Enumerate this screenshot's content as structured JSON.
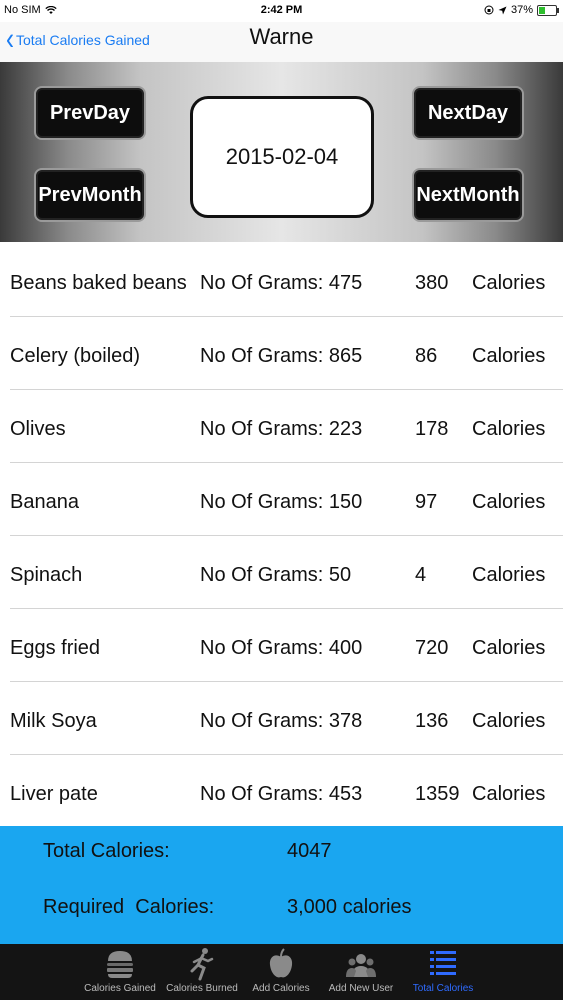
{
  "status": {
    "carrier": "No SIM",
    "time": "2:42 PM",
    "battery": "37%",
    "battery_level": 0.37
  },
  "nav": {
    "back_label": "Total Calories Gained",
    "title": "Warne"
  },
  "date_nav": {
    "prev_day": "PrevDay",
    "next_day": "NextDay",
    "prev_month": "PrevMonth",
    "next_month": "NextMonth",
    "date": "2015-02-04"
  },
  "foods": [
    {
      "name": "Beans baked beans",
      "grams": "No Of Grams: 475",
      "calories": "380",
      "unit": "Calories"
    },
    {
      "name": "Celery (boiled)",
      "grams": "No Of Grams: 865",
      "calories": "86",
      "unit": "Calories"
    },
    {
      "name": "Olives",
      "grams": "No Of Grams: 223",
      "calories": "178",
      "unit": "Calories"
    },
    {
      "name": "Banana",
      "grams": "No Of Grams: 150",
      "calories": "97",
      "unit": "Calories"
    },
    {
      "name": "Spinach",
      "grams": "No Of Grams: 50",
      "calories": "4",
      "unit": "Calories"
    },
    {
      "name": "Eggs fried",
      "grams": "No Of Grams: 400",
      "calories": "720",
      "unit": "Calories"
    },
    {
      "name": "Milk Soya",
      "grams": "No Of Grams: 378",
      "calories": "136",
      "unit": "Calories"
    },
    {
      "name": "Liver pate",
      "grams": "No Of Grams: 453",
      "calories": "1359",
      "unit": "Calories"
    }
  ],
  "totals": {
    "total_label": "Total Calories:",
    "total_value": "4047",
    "required_label": "Required  Calories:",
    "required_value": "3,000 calories"
  },
  "tabs": [
    {
      "label": "Calories Gained",
      "icon": "burger-icon"
    },
    {
      "label": "Calories Burned",
      "icon": "runner-icon"
    },
    {
      "label": "Add Calories",
      "icon": "apple-icon"
    },
    {
      "label": "Add New User",
      "icon": "users-icon"
    },
    {
      "label": "Total Calories",
      "icon": "list-icon"
    }
  ],
  "colors": {
    "accent": "#1a7cf2",
    "totals_bg": "#1aa6f0",
    "active_tab": "#2f6bff"
  }
}
